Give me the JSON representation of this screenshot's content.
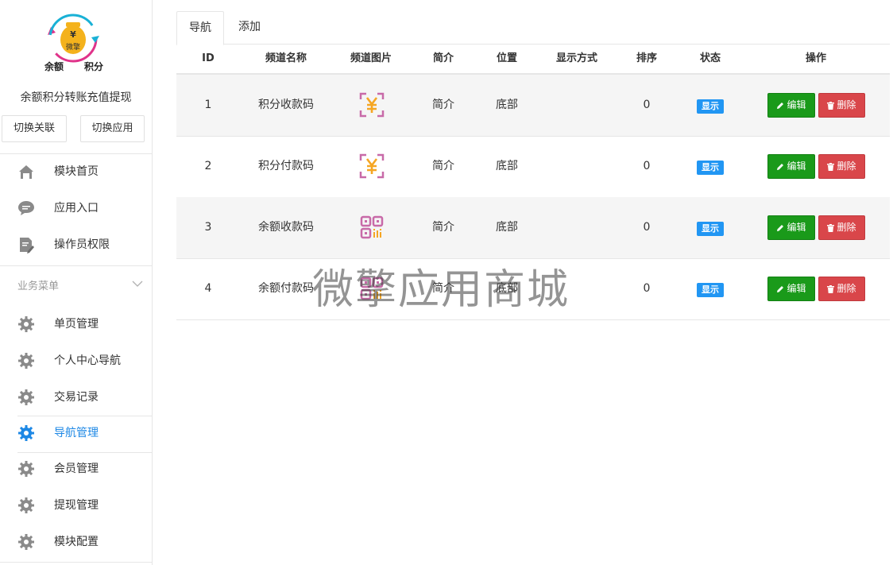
{
  "sidebar": {
    "logo": {
      "top_left_text": "余额",
      "top_right_text": "积分",
      "badge_text": "微擎",
      "coin_symbol": "¥"
    },
    "app_title": "余额积分转账充值提现",
    "switch_buttons": [
      "切换关联",
      "切换应用"
    ],
    "top_items": [
      {
        "label": "模块首页",
        "icon": "home-icon"
      },
      {
        "label": "应用入口",
        "icon": "chat-icon"
      },
      {
        "label": "操作员权限",
        "icon": "document-edit-icon"
      }
    ],
    "section_title": "业务菜单",
    "menu_items": [
      {
        "label": "单页管理",
        "icon": "gear-icon"
      },
      {
        "label": "个人中心导航",
        "icon": "gear-icon"
      },
      {
        "label": "交易记录",
        "icon": "gear-icon"
      },
      {
        "label": "导航管理",
        "icon": "gear-icon",
        "active": true
      },
      {
        "label": "会员管理",
        "icon": "gear-icon"
      },
      {
        "label": "提现管理",
        "icon": "gear-icon"
      },
      {
        "label": "模块配置",
        "icon": "gear-icon"
      }
    ],
    "active_color": "#1e88e5"
  },
  "tabs": [
    {
      "label": "导航",
      "active": true
    },
    {
      "label": "添加",
      "active": false
    }
  ],
  "table": {
    "headers": [
      "ID",
      "频道名称",
      "频道图片",
      "简介",
      "位置",
      "显示方式",
      "排序",
      "状态",
      "操作"
    ],
    "rows": [
      {
        "id": "1",
        "name": "积分收款码",
        "image": "yen-scan-icon",
        "intro": "简介",
        "position": "底部",
        "display": "",
        "sort": "0",
        "status": "显示"
      },
      {
        "id": "2",
        "name": "积分付款码",
        "image": "yen-scan-icon",
        "intro": "简介",
        "position": "底部",
        "display": "",
        "sort": "0",
        "status": "显示"
      },
      {
        "id": "3",
        "name": "余额收款码",
        "image": "qr-code-icon",
        "intro": "简介",
        "position": "底部",
        "display": "",
        "sort": "0",
        "status": "显示"
      },
      {
        "id": "4",
        "name": "余额付款码",
        "image": "qr-code-icon",
        "intro": "简介",
        "position": "底部",
        "display": "",
        "sort": "0",
        "status": "显示"
      }
    ],
    "edit_label": "编辑",
    "delete_label": "删除"
  },
  "watermark": "微擎应用商城",
  "colors": {
    "edit": "#1a9a1a",
    "delete": "#d9464a",
    "status": "#2196f3"
  }
}
